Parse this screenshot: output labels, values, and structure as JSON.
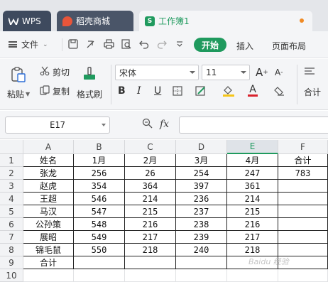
{
  "tabs": [
    {
      "label": "WPS",
      "icon": "wps-logo-icon"
    },
    {
      "label": "稻壳商城",
      "icon": "docer-logo-icon"
    },
    {
      "label": "工作簿1",
      "icon": "spreadsheet-icon"
    }
  ],
  "menu": {
    "file_label": "文件",
    "start_label": "开始",
    "insert_label": "插入",
    "layout_label": "页面布局"
  },
  "ribbon": {
    "paste_label": "粘贴",
    "cut_label": "剪切",
    "copy_label": "复制",
    "format_painter_label": "格式刷",
    "font_name": "宋体",
    "font_size": "11",
    "font_color": "#d9232d",
    "fill_color": "#f5c518",
    "align_label": "合计"
  },
  "formula_bar": {
    "cell_ref": "E17",
    "fx_label": "fx",
    "formula": ""
  },
  "sheet": {
    "columns": [
      "A",
      "B",
      "C",
      "D",
      "E",
      "F"
    ],
    "selected_column": "E",
    "rows": [
      [
        "姓名",
        "1月",
        "2月",
        "3月",
        "4月",
        "合计"
      ],
      [
        "张龙",
        "256",
        "26",
        "254",
        "247",
        "783"
      ],
      [
        "赵虎",
        "354",
        "364",
        "397",
        "361",
        ""
      ],
      [
        "王超",
        "546",
        "214",
        "236",
        "214",
        ""
      ],
      [
        "马汉",
        "547",
        "215",
        "237",
        "215",
        ""
      ],
      [
        "公孙策",
        "548",
        "216",
        "238",
        "216",
        ""
      ],
      [
        "展昭",
        "549",
        "217",
        "239",
        "217",
        ""
      ],
      [
        "锦毛鼠",
        "550",
        "218",
        "240",
        "218",
        ""
      ],
      [
        "合计",
        "",
        "",
        "",
        "",
        ""
      ]
    ]
  },
  "colors": {
    "accent": "#1f9a5e",
    "tab_dark": "#3e4a5e"
  }
}
